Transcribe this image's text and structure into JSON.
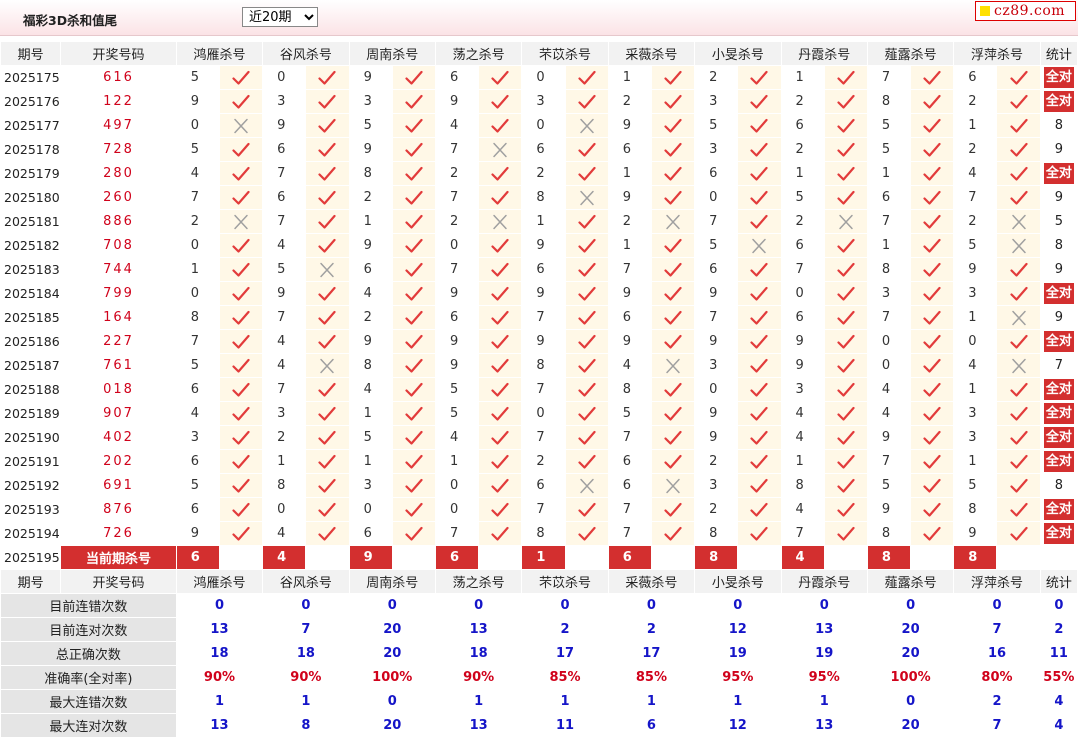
{
  "header": {
    "title": "福彩3D杀和值尾",
    "period_selected": "近20期",
    "site_logo": "cz89.com"
  },
  "columns": {
    "issue": "期号",
    "draw": "开奖号码",
    "stat": "统计"
  },
  "experts": [
    "鸿雁杀号",
    "谷风杀号",
    "周南杀号",
    "荡之杀号",
    "芣苡杀号",
    "采薇杀号",
    "小旻杀号",
    "丹霞杀号",
    "薤露杀号",
    "浮萍杀号"
  ],
  "rows": [
    {
      "issue": "2025175",
      "draw": "616",
      "kills": [
        {
          "n": "5",
          "ok": true
        },
        {
          "n": "0",
          "ok": true
        },
        {
          "n": "9",
          "ok": true
        },
        {
          "n": "6",
          "ok": true
        },
        {
          "n": "0",
          "ok": true
        },
        {
          "n": "1",
          "ok": true
        },
        {
          "n": "2",
          "ok": true
        },
        {
          "n": "1",
          "ok": true
        },
        {
          "n": "7",
          "ok": true
        },
        {
          "n": "6",
          "ok": true
        }
      ],
      "stat": "全对"
    },
    {
      "issue": "2025176",
      "draw": "122",
      "kills": [
        {
          "n": "9",
          "ok": true
        },
        {
          "n": "3",
          "ok": true
        },
        {
          "n": "3",
          "ok": true
        },
        {
          "n": "9",
          "ok": true
        },
        {
          "n": "3",
          "ok": true
        },
        {
          "n": "2",
          "ok": true
        },
        {
          "n": "3",
          "ok": true
        },
        {
          "n": "2",
          "ok": true
        },
        {
          "n": "8",
          "ok": true
        },
        {
          "n": "2",
          "ok": true
        }
      ],
      "stat": "全对"
    },
    {
      "issue": "2025177",
      "draw": "497",
      "kills": [
        {
          "n": "0",
          "ok": false
        },
        {
          "n": "9",
          "ok": true
        },
        {
          "n": "5",
          "ok": true
        },
        {
          "n": "4",
          "ok": true
        },
        {
          "n": "0",
          "ok": false
        },
        {
          "n": "9",
          "ok": true
        },
        {
          "n": "5",
          "ok": true
        },
        {
          "n": "6",
          "ok": true
        },
        {
          "n": "5",
          "ok": true
        },
        {
          "n": "1",
          "ok": true
        }
      ],
      "stat": "8"
    },
    {
      "issue": "2025178",
      "draw": "728",
      "kills": [
        {
          "n": "5",
          "ok": true
        },
        {
          "n": "6",
          "ok": true
        },
        {
          "n": "9",
          "ok": true
        },
        {
          "n": "7",
          "ok": false
        },
        {
          "n": "6",
          "ok": true
        },
        {
          "n": "6",
          "ok": true
        },
        {
          "n": "3",
          "ok": true
        },
        {
          "n": "2",
          "ok": true
        },
        {
          "n": "5",
          "ok": true
        },
        {
          "n": "2",
          "ok": true
        }
      ],
      "stat": "9"
    },
    {
      "issue": "2025179",
      "draw": "280",
      "kills": [
        {
          "n": "4",
          "ok": true
        },
        {
          "n": "7",
          "ok": true
        },
        {
          "n": "8",
          "ok": true
        },
        {
          "n": "2",
          "ok": true
        },
        {
          "n": "2",
          "ok": true
        },
        {
          "n": "1",
          "ok": true
        },
        {
          "n": "6",
          "ok": true
        },
        {
          "n": "1",
          "ok": true
        },
        {
          "n": "1",
          "ok": true
        },
        {
          "n": "4",
          "ok": true
        }
      ],
      "stat": "全对"
    },
    {
      "issue": "2025180",
      "draw": "260",
      "kills": [
        {
          "n": "7",
          "ok": true
        },
        {
          "n": "6",
          "ok": true
        },
        {
          "n": "2",
          "ok": true
        },
        {
          "n": "7",
          "ok": true
        },
        {
          "n": "8",
          "ok": false
        },
        {
          "n": "9",
          "ok": true
        },
        {
          "n": "0",
          "ok": true
        },
        {
          "n": "5",
          "ok": true
        },
        {
          "n": "6",
          "ok": true
        },
        {
          "n": "7",
          "ok": true
        }
      ],
      "stat": "9"
    },
    {
      "issue": "2025181",
      "draw": "886",
      "kills": [
        {
          "n": "2",
          "ok": false
        },
        {
          "n": "7",
          "ok": true
        },
        {
          "n": "1",
          "ok": true
        },
        {
          "n": "2",
          "ok": false
        },
        {
          "n": "1",
          "ok": true
        },
        {
          "n": "2",
          "ok": false
        },
        {
          "n": "7",
          "ok": true
        },
        {
          "n": "2",
          "ok": false
        },
        {
          "n": "7",
          "ok": true
        },
        {
          "n": "2",
          "ok": false
        }
      ],
      "stat": "5"
    },
    {
      "issue": "2025182",
      "draw": "708",
      "kills": [
        {
          "n": "0",
          "ok": true
        },
        {
          "n": "4",
          "ok": true
        },
        {
          "n": "9",
          "ok": true
        },
        {
          "n": "0",
          "ok": true
        },
        {
          "n": "9",
          "ok": true
        },
        {
          "n": "1",
          "ok": true
        },
        {
          "n": "5",
          "ok": false
        },
        {
          "n": "6",
          "ok": true
        },
        {
          "n": "1",
          "ok": true
        },
        {
          "n": "5",
          "ok": false
        }
      ],
      "stat": "8"
    },
    {
      "issue": "2025183",
      "draw": "744",
      "kills": [
        {
          "n": "1",
          "ok": true
        },
        {
          "n": "5",
          "ok": false
        },
        {
          "n": "6",
          "ok": true
        },
        {
          "n": "7",
          "ok": true
        },
        {
          "n": "6",
          "ok": true
        },
        {
          "n": "7",
          "ok": true
        },
        {
          "n": "6",
          "ok": true
        },
        {
          "n": "7",
          "ok": true
        },
        {
          "n": "8",
          "ok": true
        },
        {
          "n": "9",
          "ok": true
        }
      ],
      "stat": "9"
    },
    {
      "issue": "2025184",
      "draw": "799",
      "kills": [
        {
          "n": "0",
          "ok": true
        },
        {
          "n": "9",
          "ok": true
        },
        {
          "n": "4",
          "ok": true
        },
        {
          "n": "9",
          "ok": true
        },
        {
          "n": "9",
          "ok": true
        },
        {
          "n": "9",
          "ok": true
        },
        {
          "n": "9",
          "ok": true
        },
        {
          "n": "0",
          "ok": true
        },
        {
          "n": "3",
          "ok": true
        },
        {
          "n": "3",
          "ok": true
        }
      ],
      "stat": "全对"
    },
    {
      "issue": "2025185",
      "draw": "164",
      "kills": [
        {
          "n": "8",
          "ok": true
        },
        {
          "n": "7",
          "ok": true
        },
        {
          "n": "2",
          "ok": true
        },
        {
          "n": "6",
          "ok": true
        },
        {
          "n": "7",
          "ok": true
        },
        {
          "n": "6",
          "ok": true
        },
        {
          "n": "7",
          "ok": true
        },
        {
          "n": "6",
          "ok": true
        },
        {
          "n": "7",
          "ok": true
        },
        {
          "n": "1",
          "ok": false
        }
      ],
      "stat": "9"
    },
    {
      "issue": "2025186",
      "draw": "227",
      "kills": [
        {
          "n": "7",
          "ok": true
        },
        {
          "n": "4",
          "ok": true
        },
        {
          "n": "9",
          "ok": true
        },
        {
          "n": "9",
          "ok": true
        },
        {
          "n": "9",
          "ok": true
        },
        {
          "n": "9",
          "ok": true
        },
        {
          "n": "9",
          "ok": true
        },
        {
          "n": "9",
          "ok": true
        },
        {
          "n": "0",
          "ok": true
        },
        {
          "n": "0",
          "ok": true
        }
      ],
      "stat": "全对"
    },
    {
      "issue": "2025187",
      "draw": "761",
      "kills": [
        {
          "n": "5",
          "ok": true
        },
        {
          "n": "4",
          "ok": false
        },
        {
          "n": "8",
          "ok": true
        },
        {
          "n": "9",
          "ok": true
        },
        {
          "n": "8",
          "ok": true
        },
        {
          "n": "4",
          "ok": false
        },
        {
          "n": "3",
          "ok": true
        },
        {
          "n": "9",
          "ok": true
        },
        {
          "n": "0",
          "ok": true
        },
        {
          "n": "4",
          "ok": false
        }
      ],
      "stat": "7"
    },
    {
      "issue": "2025188",
      "draw": "018",
      "kills": [
        {
          "n": "6",
          "ok": true
        },
        {
          "n": "7",
          "ok": true
        },
        {
          "n": "4",
          "ok": true
        },
        {
          "n": "5",
          "ok": true
        },
        {
          "n": "7",
          "ok": true
        },
        {
          "n": "8",
          "ok": true
        },
        {
          "n": "0",
          "ok": true
        },
        {
          "n": "3",
          "ok": true
        },
        {
          "n": "4",
          "ok": true
        },
        {
          "n": "1",
          "ok": true
        }
      ],
      "stat": "全对"
    },
    {
      "issue": "2025189",
      "draw": "907",
      "kills": [
        {
          "n": "4",
          "ok": true
        },
        {
          "n": "3",
          "ok": true
        },
        {
          "n": "1",
          "ok": true
        },
        {
          "n": "5",
          "ok": true
        },
        {
          "n": "0",
          "ok": true
        },
        {
          "n": "5",
          "ok": true
        },
        {
          "n": "9",
          "ok": true
        },
        {
          "n": "4",
          "ok": true
        },
        {
          "n": "4",
          "ok": true
        },
        {
          "n": "3",
          "ok": true
        }
      ],
      "stat": "全对"
    },
    {
      "issue": "2025190",
      "draw": "402",
      "kills": [
        {
          "n": "3",
          "ok": true
        },
        {
          "n": "2",
          "ok": true
        },
        {
          "n": "5",
          "ok": true
        },
        {
          "n": "4",
          "ok": true
        },
        {
          "n": "7",
          "ok": true
        },
        {
          "n": "7",
          "ok": true
        },
        {
          "n": "9",
          "ok": true
        },
        {
          "n": "4",
          "ok": true
        },
        {
          "n": "9",
          "ok": true
        },
        {
          "n": "3",
          "ok": true
        }
      ],
      "stat": "全对"
    },
    {
      "issue": "2025191",
      "draw": "202",
      "kills": [
        {
          "n": "6",
          "ok": true
        },
        {
          "n": "1",
          "ok": true
        },
        {
          "n": "1",
          "ok": true
        },
        {
          "n": "1",
          "ok": true
        },
        {
          "n": "2",
          "ok": true
        },
        {
          "n": "6",
          "ok": true
        },
        {
          "n": "2",
          "ok": true
        },
        {
          "n": "1",
          "ok": true
        },
        {
          "n": "7",
          "ok": true
        },
        {
          "n": "1",
          "ok": true
        }
      ],
      "stat": "全对"
    },
    {
      "issue": "2025192",
      "draw": "691",
      "kills": [
        {
          "n": "5",
          "ok": true
        },
        {
          "n": "8",
          "ok": true
        },
        {
          "n": "3",
          "ok": true
        },
        {
          "n": "0",
          "ok": true
        },
        {
          "n": "6",
          "ok": false
        },
        {
          "n": "6",
          "ok": false
        },
        {
          "n": "3",
          "ok": true
        },
        {
          "n": "8",
          "ok": true
        },
        {
          "n": "5",
          "ok": true
        },
        {
          "n": "5",
          "ok": true
        }
      ],
      "stat": "8"
    },
    {
      "issue": "2025193",
      "draw": "876",
      "kills": [
        {
          "n": "6",
          "ok": true
        },
        {
          "n": "0",
          "ok": true
        },
        {
          "n": "0",
          "ok": true
        },
        {
          "n": "0",
          "ok": true
        },
        {
          "n": "7",
          "ok": true
        },
        {
          "n": "7",
          "ok": true
        },
        {
          "n": "2",
          "ok": true
        },
        {
          "n": "4",
          "ok": true
        },
        {
          "n": "9",
          "ok": true
        },
        {
          "n": "8",
          "ok": true
        }
      ],
      "stat": "全对"
    },
    {
      "issue": "2025194",
      "draw": "726",
      "kills": [
        {
          "n": "9",
          "ok": true
        },
        {
          "n": "4",
          "ok": true
        },
        {
          "n": "6",
          "ok": true
        },
        {
          "n": "7",
          "ok": true
        },
        {
          "n": "8",
          "ok": true
        },
        {
          "n": "7",
          "ok": true
        },
        {
          "n": "8",
          "ok": true
        },
        {
          "n": "7",
          "ok": true
        },
        {
          "n": "8",
          "ok": true
        },
        {
          "n": "9",
          "ok": true
        }
      ],
      "stat": "全对"
    }
  ],
  "current": {
    "issue": "2025195",
    "label": "当前期杀号",
    "kills": [
      "6",
      "4",
      "9",
      "6",
      "1",
      "6",
      "8",
      "4",
      "8",
      "8"
    ]
  },
  "stats": [
    {
      "label": "目前连错次数",
      "values": [
        "0",
        "0",
        "0",
        "0",
        "0",
        "0",
        "0",
        "0",
        "0",
        "0"
      ],
      "total": "0"
    },
    {
      "label": "目前连对次数",
      "values": [
        "13",
        "7",
        "20",
        "13",
        "2",
        "2",
        "12",
        "13",
        "20",
        "7"
      ],
      "total": "2"
    },
    {
      "label": "总正确次数",
      "values": [
        "18",
        "18",
        "20",
        "18",
        "17",
        "17",
        "19",
        "19",
        "20",
        "16"
      ],
      "total": "11"
    },
    {
      "label": "准确率(全对率)",
      "values": [
        "90%",
        "90%",
        "100%",
        "90%",
        "85%",
        "85%",
        "95%",
        "95%",
        "100%",
        "80%"
      ],
      "total": "55%",
      "red": true
    },
    {
      "label": "最大连错次数",
      "values": [
        "1",
        "1",
        "0",
        "1",
        "1",
        "1",
        "1",
        "1",
        "0",
        "2"
      ],
      "total": "4"
    },
    {
      "label": "最大连对次数",
      "values": [
        "13",
        "8",
        "20",
        "13",
        "11",
        "6",
        "12",
        "13",
        "20",
        "7"
      ],
      "total": "4"
    }
  ],
  "colors": {
    "accent": "#d32f2f",
    "check": "#e23b3b",
    "cross": "#9a9a9a",
    "stat_blue": "#1515c8"
  }
}
